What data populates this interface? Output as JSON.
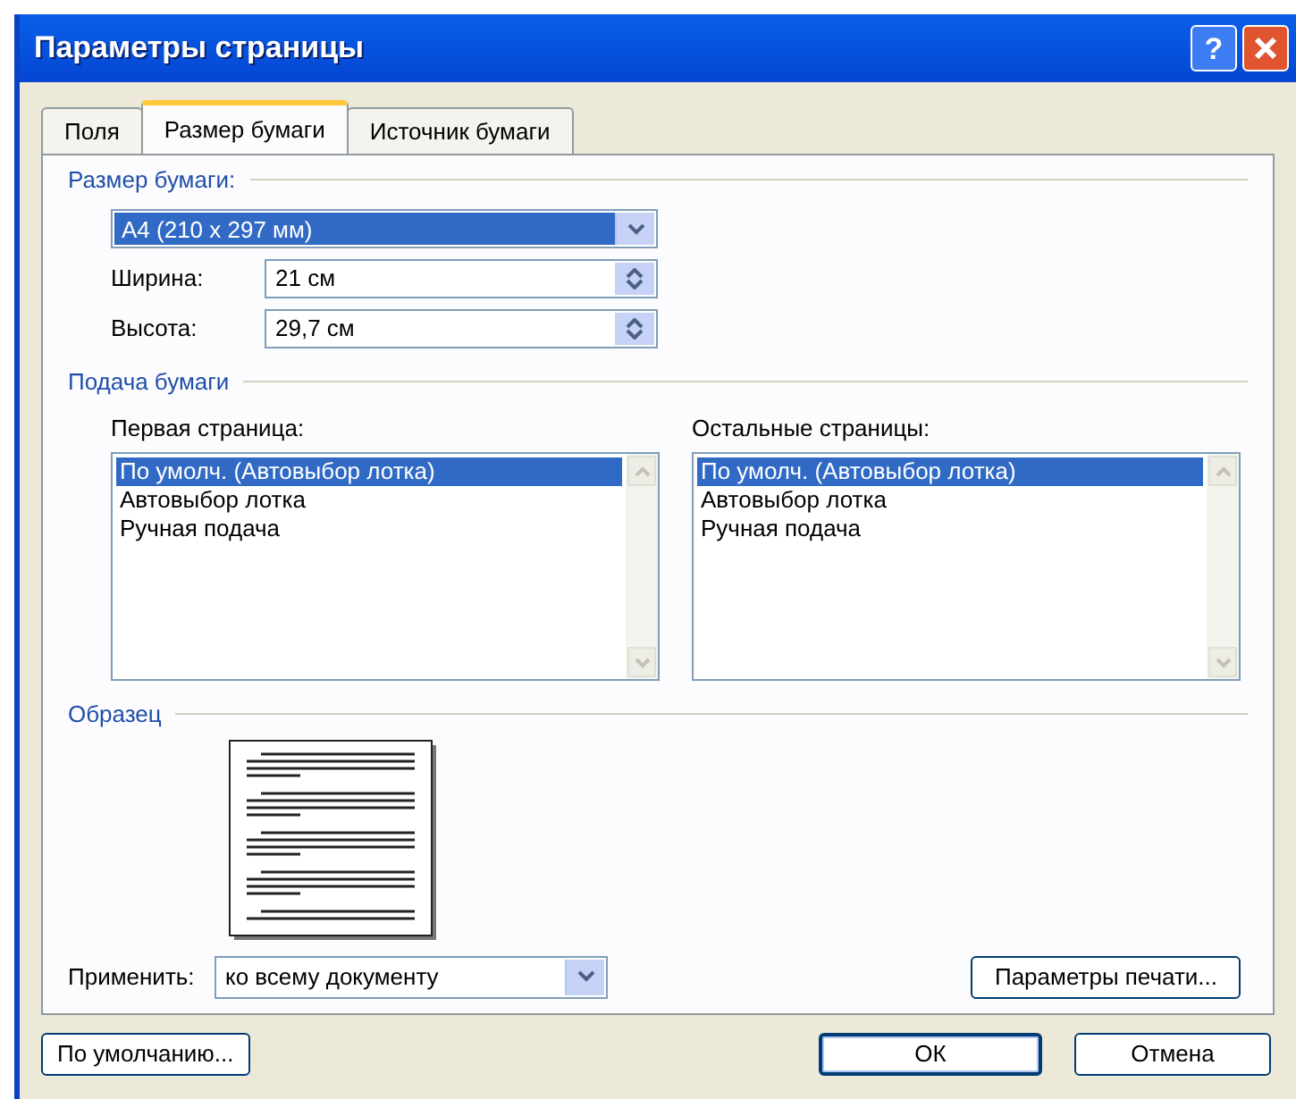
{
  "window": {
    "title": "Параметры страницы",
    "help_button": "?"
  },
  "tabs": [
    {
      "label": "Поля",
      "selected": false
    },
    {
      "label": "Размер бумаги",
      "selected": true
    },
    {
      "label": "Источник бумаги",
      "selected": false
    }
  ],
  "paper_size": {
    "heading": "Размер бумаги:",
    "value": "A4 (210 x 297 мм)",
    "width": {
      "label": "Ширина:",
      "value": "21 см"
    },
    "height": {
      "label": "Высота:",
      "value": "29,7 см"
    }
  },
  "paper_feed": {
    "heading": "Подача бумаги",
    "lists": [
      {
        "label": "Первая страница:",
        "items": [
          {
            "text": "По умолч. (Автовыбор лотка)",
            "selected": true
          },
          {
            "text": "Автовыбор лотка",
            "selected": false
          },
          {
            "text": "Ручная подача",
            "selected": false
          }
        ]
      },
      {
        "label": "Остальные страницы:",
        "items": [
          {
            "text": "По умолч. (Автовыбор лотка)",
            "selected": true
          },
          {
            "text": "Автовыбор лотка",
            "selected": false
          },
          {
            "text": "Ручная подача",
            "selected": false
          }
        ]
      }
    ]
  },
  "preview": {
    "heading": "Образец"
  },
  "apply": {
    "label": "Применить:",
    "value": "ко всему документу"
  },
  "print_options_button": "Параметры печати...",
  "buttons": [
    {
      "label": "По умолчанию...",
      "kind": "left"
    },
    {
      "label": "ОК",
      "kind": "default"
    },
    {
      "label": "Отмена",
      "kind": "normal"
    }
  ]
}
